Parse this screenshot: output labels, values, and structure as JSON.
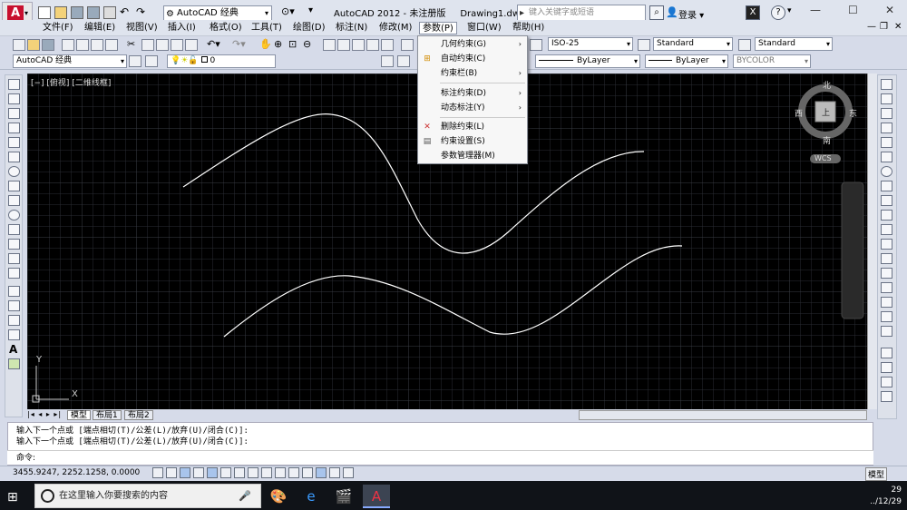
{
  "window": {
    "title": "AutoCAD 2012 - 未注册版",
    "document": "Drawing1.dwg",
    "workspace": "AutoCAD 经典",
    "search_placeholder": "键入关键字或短语",
    "login": "登录"
  },
  "menubar": [
    "文件(F)",
    "编辑(E)",
    "视图(V)",
    "插入(I)",
    "格式(O)",
    "工具(T)",
    "绘图(D)",
    "标注(N)",
    "修改(M)",
    "参数(P)",
    "窗口(W)",
    "帮助(H)"
  ],
  "param_menu": {
    "items": [
      {
        "label": "几何约束(G)",
        "submenu": true,
        "icon": ""
      },
      {
        "label": "自动约束(C)",
        "submenu": false,
        "icon": "auto-constrain-icon"
      },
      {
        "label": "约束栏(B)",
        "submenu": true,
        "icon": ""
      },
      {
        "label": "标注约束(D)",
        "submenu": true,
        "icon": ""
      },
      {
        "label": "动态标注(Y)",
        "submenu": true,
        "icon": ""
      },
      {
        "label": "删除约束(L)",
        "submenu": false,
        "icon": "delete-constraint-icon"
      },
      {
        "label": "约束设置(S)",
        "submenu": false,
        "icon": "constraint-settings-icon"
      },
      {
        "label": "参数管理器(M)",
        "submenu": false,
        "icon": ""
      }
    ]
  },
  "toolbar": {
    "dimstyle": "ISO-25",
    "textstyle": "Standard",
    "tablestyle": "Standard",
    "workspace2": "AutoCAD 经典",
    "layer": "0",
    "linetype": "ByLayer",
    "lineweight": "ByLayer",
    "color": "BYCOLOR"
  },
  "viewport": {
    "label": "[−] [俯视] [二维线框]",
    "compass": {
      "north": "北",
      "south": "南",
      "east": "东",
      "west": "西",
      "top": "上"
    },
    "wcs": "WCS",
    "ucs_y": "Y",
    "ucs_x": "X"
  },
  "tabs": [
    "模型",
    "布局1",
    "布局2"
  ],
  "command": {
    "history": [
      "输入下一个点或 [端点相切(T)/公差(L)/放弃(U)/闭合(C)]:",
      "输入下一个点或 [端点相切(T)/公差(L)/放弃(U)/闭合(C)]:"
    ],
    "prompt": "命令:"
  },
  "status": {
    "coords": "3455.9247, 2252.1258, 0.0000",
    "model": "模型"
  },
  "taskbar": {
    "search": "在这里输入你要搜索的内容",
    "time": "29",
    "date": "../12/29"
  },
  "colors": {
    "canvas": "#000000",
    "curve": "#ffffff",
    "accent": "#c8102e"
  }
}
